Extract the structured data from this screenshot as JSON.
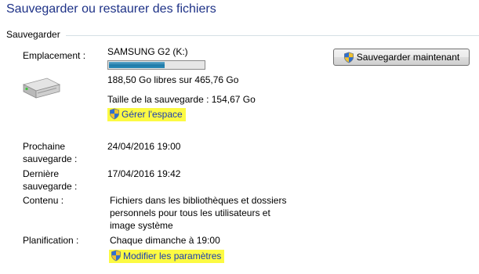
{
  "page": {
    "title": "Sauvegarder ou restaurer des fichiers",
    "section_label": "Sauvegarder"
  },
  "backup": {
    "location_label": "Emplacement :",
    "location_value": "SAMSUNG G2 (K:)",
    "space_used_fraction": 0.595,
    "free_space_text": "188,50 Go libres sur 465,76 Go",
    "backup_size_text": "Taille de la sauvegarde : 154,67 Go",
    "manage_space_link": "Gérer l'espace",
    "next_backup_label": "Prochaine sauvegarde :",
    "next_backup_value": "24/04/2016 19:00",
    "last_backup_label": "Dernière sauvegarde :",
    "last_backup_value": "17/04/2016 19:42",
    "contents_label": "Contenu :",
    "contents_value": "Fichiers dans les bibliothèques et dossiers personnels pour tous les utilisateurs et image système",
    "schedule_label": "Planification :",
    "schedule_value": "Chaque dimanche à 19:00",
    "change_settings_link": "Modifier les paramètres",
    "backup_now_button": "Sauvegarder maintenant"
  },
  "icons": {
    "drive": "hard-drive-icon",
    "uac_shield": "uac-shield-icon"
  },
  "colors": {
    "title": "#1e3287",
    "link": "#1a3db4",
    "highlight": "#fcfa42",
    "progress_fill": "#1f7aa8"
  }
}
